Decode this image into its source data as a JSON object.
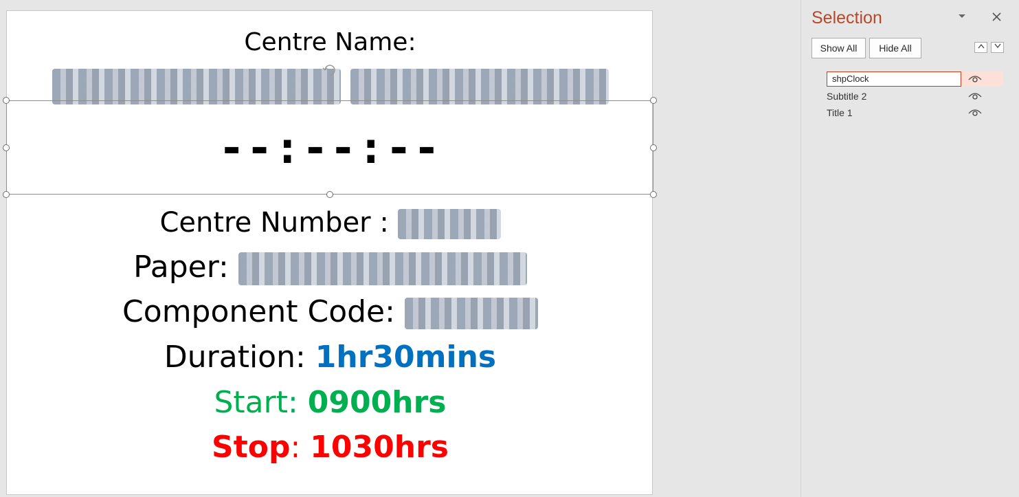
{
  "slide": {
    "centre_name_label": "Centre Name:",
    "clock": "--:--:--",
    "centre_number_label": "Centre Number : ",
    "paper_label": "Paper: ",
    "component_code_label": "Component Code: ",
    "duration_label": "Duration: ",
    "duration_value": "1hr30mins",
    "start_label": "Start: ",
    "start_value": "0900hrs",
    "stop_label": "Stop",
    "stop_colon": ": ",
    "stop_value": "1030hrs"
  },
  "selection_pane": {
    "title": "Selection",
    "show_all": "Show All",
    "hide_all": "Hide All",
    "items": [
      {
        "name": "shpClock",
        "selected": true,
        "visible": true
      },
      {
        "name": "Subtitle 2",
        "selected": false,
        "visible": true
      },
      {
        "name": "Title 1",
        "selected": false,
        "visible": true
      }
    ]
  },
  "colors": {
    "pane_title": "#b7472a",
    "duration": "#0070c0",
    "start": "#00b050",
    "stop": "#ff0000"
  },
  "icons": [
    "dropdown-icon",
    "close-icon",
    "move-up-icon",
    "move-down-icon",
    "eye-icon",
    "rotate-handle-icon"
  ]
}
